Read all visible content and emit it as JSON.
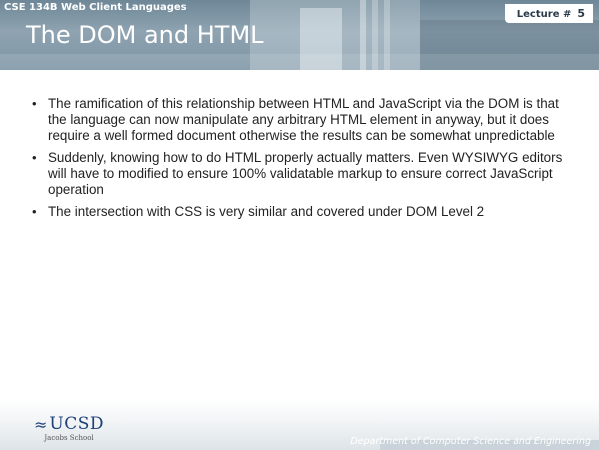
{
  "header": {
    "course": "CSE 134B  Web Client Languages",
    "lecture_label": "Lecture #",
    "lecture_number": "5",
    "title": "The DOM and HTML"
  },
  "bullets": [
    "The ramification of this relationship between HTML and JavaScript via the DOM is that the language can now manipulate any arbitrary HTML element in anyway, but it does require a well formed document otherwise the results can be somewhat unpredictable",
    "Suddenly, knowing how to do HTML properly actually matters.  Even WYSIWYG editors will have to modified to ensure 100% validatable markup to ensure correct JavaScript operation",
    "The intersection with CSS is very similar and covered under DOM Level 2"
  ],
  "footer": {
    "logo_text": "UCSD",
    "logo_subtext": "Jacobs School",
    "department": "Department of Computer Science and Engineering"
  }
}
